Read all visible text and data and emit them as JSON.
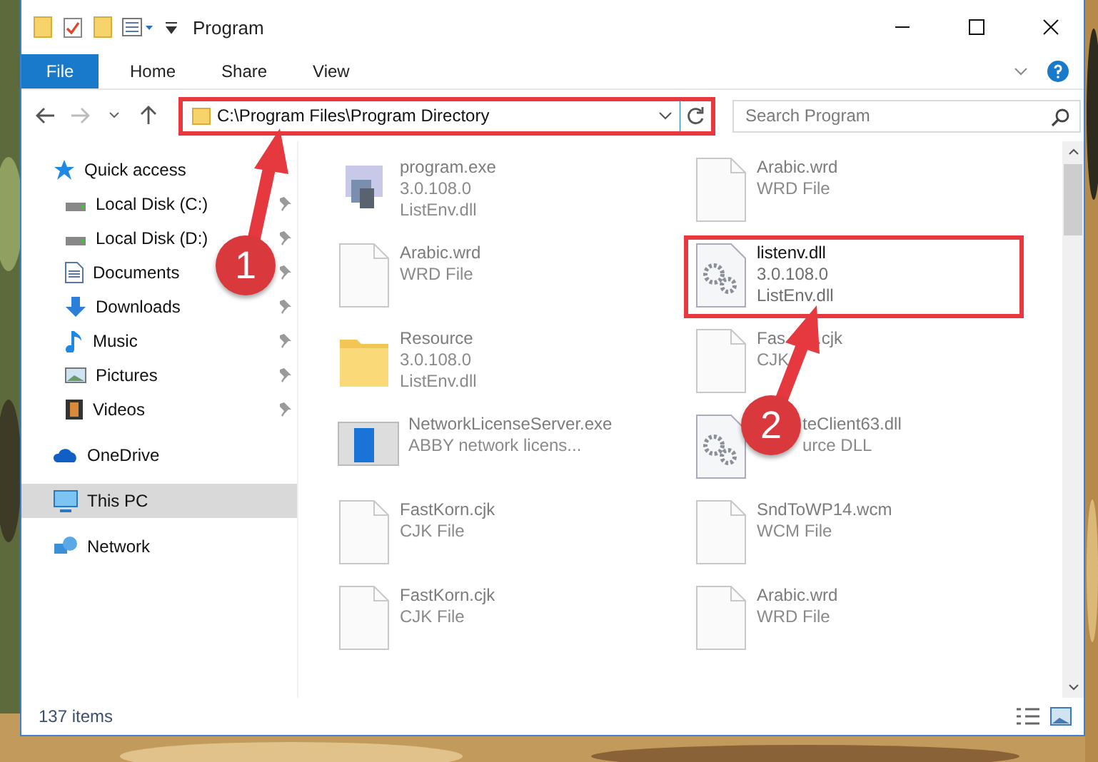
{
  "window": {
    "title": "Program"
  },
  "ribbon_tabs": [
    {
      "label": "File",
      "kind": "file",
      "selected": false
    },
    {
      "label": "Home",
      "kind": "tab",
      "selected": false
    },
    {
      "label": "Share",
      "kind": "tab",
      "selected": false
    },
    {
      "label": "View",
      "kind": "tab",
      "selected": false
    }
  ],
  "address": {
    "path": "C:\\Program Files\\Program Directory",
    "outlined": true
  },
  "search": {
    "placeholder": "Search Program"
  },
  "nav": [
    {
      "label": "Quick access",
      "selected": false,
      "children": [
        {
          "label": "Local Disk (C:)",
          "selected": false,
          "pinned": true
        },
        {
          "label": "Local Disk (D:)",
          "selected": false,
          "pinned": true
        },
        {
          "label": "Documents",
          "selected": false,
          "pinned": true
        },
        {
          "label": "Downloads",
          "selected": false,
          "pinned": true
        },
        {
          "label": "Music",
          "selected": false,
          "pinned": true
        },
        {
          "label": "Pictures",
          "selected": false,
          "pinned": true
        },
        {
          "label": "Videos",
          "selected": false,
          "pinned": true
        }
      ]
    },
    {
      "label": "OneDrive",
      "selected": false
    },
    {
      "label": "This PC",
      "selected": true
    },
    {
      "label": "Network",
      "selected": false
    }
  ],
  "files": [
    {
      "name": "program.exe",
      "lines": [
        "3.0.108.0",
        "ListEnv.dll"
      ],
      "faded": true
    },
    {
      "name": "Arabic.wrd",
      "lines": [
        "WRD File"
      ],
      "faded": true
    },
    {
      "name": "Arabic.wrd",
      "lines": [
        "WRD File"
      ],
      "faded": true
    },
    {
      "name": "listenv.dll",
      "lines": [
        "3.0.108.0",
        "ListEnv.dll"
      ],
      "faded": false,
      "outlined": true
    },
    {
      "name": "Resource",
      "lines": [
        "3.0.108.0",
        "ListEnv.dll"
      ],
      "faded": true
    },
    {
      "name": "Fas",
      "name_rest": ".cjk",
      "lines": [
        "CJK"
      ],
      "faded": true
    },
    {
      "name": "NetworkLicenseServer.exe",
      "lines": [
        "ABBY network licens..."
      ],
      "faded": true
    },
    {
      "name": "teClient63.dll",
      "lines": [
        "urce DLL"
      ],
      "faded": true,
      "covered": true
    },
    {
      "name": "FastKorn.cjk",
      "lines": [
        "CJK File"
      ],
      "faded": true
    },
    {
      "name": "SndToWP14.wcm",
      "lines": [
        "WCM File"
      ],
      "faded": true
    },
    {
      "name": "FastKorn.cjk",
      "lines": [
        "CJK File"
      ],
      "faded": true
    },
    {
      "name": "Arabic.wrd",
      "lines": [
        "WRD File"
      ],
      "faded": true
    }
  ],
  "status_bar": {
    "count": "137 items"
  },
  "annotations": {
    "badges": [
      "1",
      "2"
    ]
  }
}
